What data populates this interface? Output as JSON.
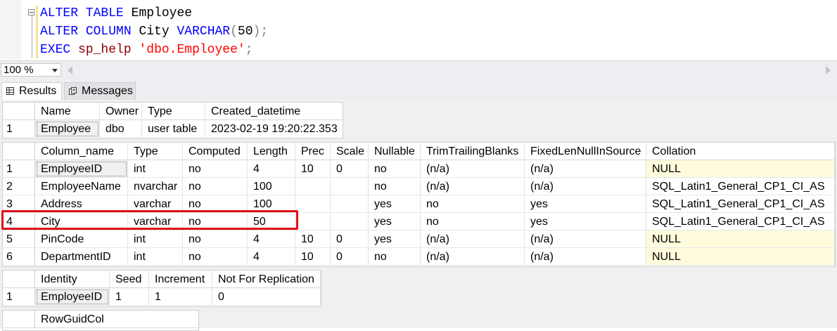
{
  "editor": {
    "line1": {
      "kw1": "ALTER",
      "kw2": "TABLE",
      "name": "Employee"
    },
    "line2": {
      "kw1": "ALTER",
      "kw2": "COLUMN",
      "col": "City",
      "type": "VARCHAR",
      "open": "(",
      "len": "50",
      "close": ");"
    },
    "line3": {
      "kw": "EXEC",
      "proc": "sp_help",
      "arg": "'dbo.Employee'",
      "end": ";"
    }
  },
  "zoom": {
    "value": "100 %"
  },
  "tabs": {
    "results": "Results",
    "messages": "Messages"
  },
  "grid1": {
    "headers": [
      "Name",
      "Owner",
      "Type",
      "Created_datetime"
    ],
    "rows": [
      {
        "num": "1",
        "cells": [
          "Employee",
          "dbo",
          "user table",
          "2023-02-19 19:20:22.353"
        ]
      }
    ]
  },
  "grid2": {
    "headers": [
      "Column_name",
      "Type",
      "Computed",
      "Length",
      "Prec",
      "Scale",
      "Nullable",
      "TrimTrailingBlanks",
      "FixedLenNullInSource",
      "Collation"
    ],
    "rows": [
      {
        "num": "1",
        "cells": [
          "EmployeeID",
          "int",
          "no",
          "4",
          "10",
          "0",
          "no",
          "(n/a)",
          "(n/a)",
          "NULL"
        ]
      },
      {
        "num": "2",
        "cells": [
          "EmployeeName",
          "nvarchar",
          "no",
          "100",
          "",
          "",
          "no",
          "(n/a)",
          "(n/a)",
          "SQL_Latin1_General_CP1_CI_AS"
        ]
      },
      {
        "num": "3",
        "cells": [
          "Address",
          "varchar",
          "no",
          "100",
          "",
          "",
          "yes",
          "no",
          "yes",
          "SQL_Latin1_General_CP1_CI_AS"
        ]
      },
      {
        "num": "4",
        "cells": [
          "City",
          "varchar",
          "no",
          "50",
          "",
          "",
          "yes",
          "no",
          "yes",
          "SQL_Latin1_General_CP1_CI_AS"
        ]
      },
      {
        "num": "5",
        "cells": [
          "PinCode",
          "int",
          "no",
          "4",
          "10",
          "0",
          "yes",
          "(n/a)",
          "(n/a)",
          "NULL"
        ]
      },
      {
        "num": "6",
        "cells": [
          "DepartmentID",
          "int",
          "no",
          "4",
          "10",
          "0",
          "no",
          "(n/a)",
          "(n/a)",
          "NULL"
        ]
      }
    ]
  },
  "grid3": {
    "headers": [
      "Identity",
      "Seed",
      "Increment",
      "Not For Replication"
    ],
    "rows": [
      {
        "num": "1",
        "cells": [
          "EmployeeID",
          "1",
          "1",
          "0"
        ]
      }
    ]
  },
  "grid4": {
    "headers": [
      "RowGuidCol"
    ]
  },
  "colors": {
    "highlight": "#e0101b",
    "null_cell": "#fffbdd",
    "keyword": "#0000ff",
    "string": "#ff0000",
    "proc": "#8b0000"
  }
}
